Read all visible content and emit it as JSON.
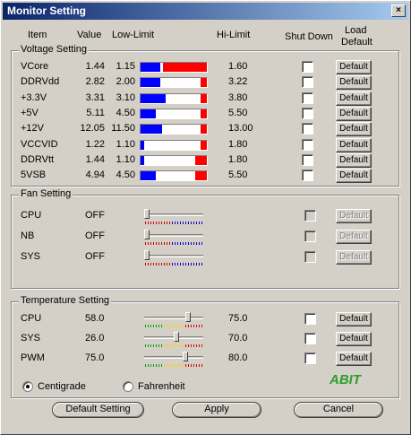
{
  "window": {
    "title": "Monitor Setting",
    "close_glyph": "×"
  },
  "headers": {
    "item": "Item",
    "value": "Value",
    "low_limit": "Low-Limit",
    "hi_limit": "Hi-Limit",
    "shut_down": "Shut Down",
    "load_default_1": "Load",
    "load_default_2": "Default"
  },
  "voltage": {
    "group_label": "Voltage Setting",
    "rows": [
      {
        "item": "VCore",
        "value": "1.44",
        "low": "1.15",
        "hi": "1.60",
        "button": "Default",
        "low_level": 0.3,
        "hi_level": 0.66
      },
      {
        "item": "DDRVdd",
        "value": "2.82",
        "low": "2.00",
        "hi": "3.22",
        "button": "Default",
        "low_level": 0.3,
        "hi_level": 0.1
      },
      {
        "item": "+3.3V",
        "value": "3.31",
        "low": "3.10",
        "hi": "3.80",
        "button": "Default",
        "low_level": 0.38,
        "hi_level": 0.1
      },
      {
        "item": "+5V",
        "value": "5.11",
        "low": "4.50",
        "hi": "5.50",
        "button": "Default",
        "low_level": 0.23,
        "hi_level": 0.1
      },
      {
        "item": "+12V",
        "value": "12.05",
        "low": "11.50",
        "hi": "13.00",
        "button": "Default",
        "low_level": 0.32,
        "hi_level": 0.1
      },
      {
        "item": "VCCVID",
        "value": "1.22",
        "low": "1.10",
        "hi": "1.80",
        "button": "Default",
        "low_level": 0.06,
        "hi_level": 0.1
      },
      {
        "item": "DDRVtt",
        "value": "1.44",
        "low": "1.10",
        "hi": "1.80",
        "button": "Default",
        "low_level": 0.06,
        "hi_level": 0.18
      },
      {
        "item": "5VSB",
        "value": "4.94",
        "low": "4.50",
        "hi": "5.50",
        "button": "Default",
        "low_level": 0.23,
        "hi_level": 0.18
      }
    ]
  },
  "fan": {
    "group_label": "Fan Setting",
    "rows": [
      {
        "item": "CPU",
        "value": "OFF",
        "button": "Default",
        "level": 0.0
      },
      {
        "item": "NB",
        "value": "OFF",
        "button": "Default",
        "level": 0.0
      },
      {
        "item": "SYS",
        "value": "OFF",
        "button": "Default",
        "level": 0.0
      }
    ]
  },
  "temperature": {
    "group_label": "Temperature Setting",
    "rows": [
      {
        "item": "CPU",
        "value": "58.0",
        "hi": "75.0",
        "button": "Default",
        "level": 0.76
      },
      {
        "item": "SYS",
        "value": "26.0",
        "hi": "70.0",
        "button": "Default",
        "level": 0.55
      },
      {
        "item": "PWM",
        "value": "75.0",
        "hi": "80.0",
        "button": "Default",
        "level": 0.72
      }
    ]
  },
  "units": {
    "centigrade": "Centigrade",
    "fahrenheit": "Fahrenheit",
    "selected": "centigrade"
  },
  "logo_text": "ABIT",
  "footer": {
    "default_setting": "Default Setting",
    "apply": "Apply",
    "cancel": "Cancel"
  }
}
